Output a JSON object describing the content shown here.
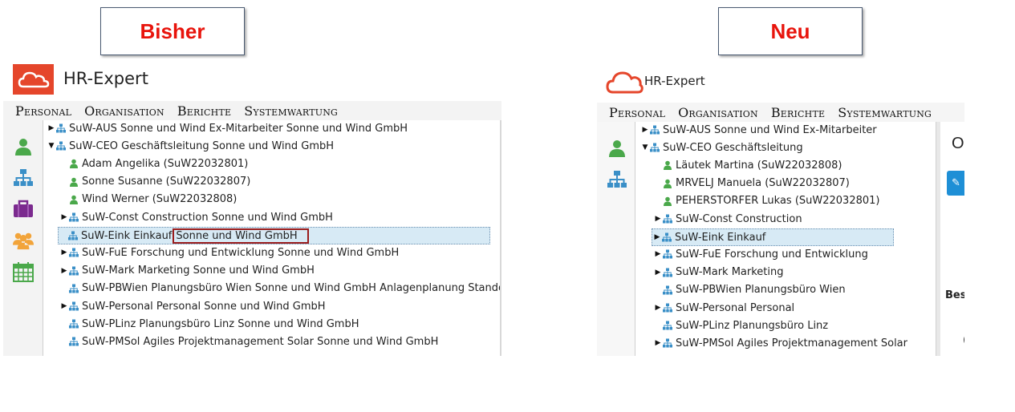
{
  "labels": {
    "left": "Bisher",
    "right": "Neu"
  },
  "app": {
    "title": "HR-Expert"
  },
  "menu": [
    "Personal",
    "Organisation",
    "Berichte",
    "Systemwartung"
  ],
  "sidebar_icons": [
    "person-icon",
    "org-chart-icon",
    "briefcase-icon",
    "group-icon",
    "calendar-icon"
  ],
  "colors": {
    "label_red": "#e8140c",
    "logo_red": "#e5462b",
    "org_icon": "#3a8fc7",
    "person_icon": "#4aa84a",
    "selection": "#d7eaf5",
    "highlight_box": "#9b1c1c"
  },
  "old_tree": [
    {
      "text": "SuW-AUS Sonne und Wind Ex-Mitarbeiter Sonne und Wind GmbH",
      "level": 0,
      "toggle": "collapsed",
      "icon": "org"
    },
    {
      "text": "SuW-CEO Geschäftsleitung Sonne und Wind GmbH",
      "level": 0,
      "toggle": "expanded",
      "icon": "org"
    },
    {
      "text": "Adam Angelika (SuW22032801)",
      "level": 1,
      "toggle": "none",
      "icon": "person"
    },
    {
      "text": "Sonne Susanne (SuW22032807)",
      "level": 1,
      "toggle": "none",
      "icon": "person"
    },
    {
      "text": "Wind Werner (SuW22032808)",
      "level": 1,
      "toggle": "none",
      "icon": "person"
    },
    {
      "text": "SuW-Const Construction Sonne und Wind GmbH",
      "level": 1,
      "toggle": "collapsed",
      "icon": "org"
    },
    {
      "text": "SuW-Eink Einkauf",
      "text2": "Sonne und Wind GmbH",
      "level": 1,
      "toggle": "none",
      "icon": "org",
      "selected": true
    },
    {
      "text": "SuW-FuE Forschung und Entwicklung Sonne und Wind GmbH",
      "level": 1,
      "toggle": "collapsed",
      "icon": "org"
    },
    {
      "text": "SuW-Mark Marketing Sonne und Wind GmbH",
      "level": 1,
      "toggle": "collapsed",
      "icon": "org"
    },
    {
      "text": "SuW-PBWien Planungsbüro Wien Sonne und Wind GmbH Anlagenplanung Standort",
      "level": 1,
      "toggle": "none",
      "icon": "org"
    },
    {
      "text": "SuW-Personal Personal Sonne und Wind GmbH",
      "level": 1,
      "toggle": "collapsed",
      "icon": "org"
    },
    {
      "text": "SuW-PLinz Planungsbüro Linz Sonne und Wind GmbH",
      "level": 1,
      "toggle": "none",
      "icon": "org"
    },
    {
      "text": "SuW-PMSol Agiles Projektmanagement Solar Sonne und Wind GmbH",
      "level": 1,
      "toggle": "none",
      "icon": "org"
    }
  ],
  "new_tree": [
    {
      "text": "SuW-AUS Sonne und Wind Ex-Mitarbeiter",
      "level": 0,
      "toggle": "collapsed",
      "icon": "org"
    },
    {
      "text": "SuW-CEO Geschäftsleitung",
      "level": 0,
      "toggle": "expanded",
      "icon": "org"
    },
    {
      "text": "Läutek Martina (SuW22032808)",
      "level": 1,
      "toggle": "none",
      "icon": "person"
    },
    {
      "text": "MRVELJ Manuela (SuW22032807)",
      "level": 1,
      "toggle": "none",
      "icon": "person"
    },
    {
      "text": "PEHERSTORFER Lukas (SuW22032801)",
      "level": 1,
      "toggle": "none",
      "icon": "person"
    },
    {
      "text": "SuW-Const Construction",
      "level": 1,
      "toggle": "collapsed",
      "icon": "org"
    },
    {
      "text": "SuW-Eink Einkauf",
      "level": 1,
      "toggle": "collapsed",
      "icon": "org",
      "selected": true
    },
    {
      "text": "SuW-FuE Forschung und Entwicklung",
      "level": 1,
      "toggle": "collapsed",
      "icon": "org"
    },
    {
      "text": "SuW-Mark Marketing",
      "level": 1,
      "toggle": "collapsed",
      "icon": "org"
    },
    {
      "text": "SuW-PBWien Planungsbüro Wien",
      "level": 1,
      "toggle": "none",
      "icon": "org"
    },
    {
      "text": "SuW-Personal Personal",
      "level": 1,
      "toggle": "collapsed",
      "icon": "org"
    },
    {
      "text": "SuW-PLinz Planungsbüro Linz",
      "level": 1,
      "toggle": "none",
      "icon": "org"
    },
    {
      "text": "SuW-PMSol Agiles Projektmanagement Solar",
      "level": 1,
      "toggle": "collapsed",
      "icon": "org"
    }
  ],
  "right_pane": {
    "heading_partial": "O",
    "section_partial": "Bes",
    "value_partial": "("
  }
}
